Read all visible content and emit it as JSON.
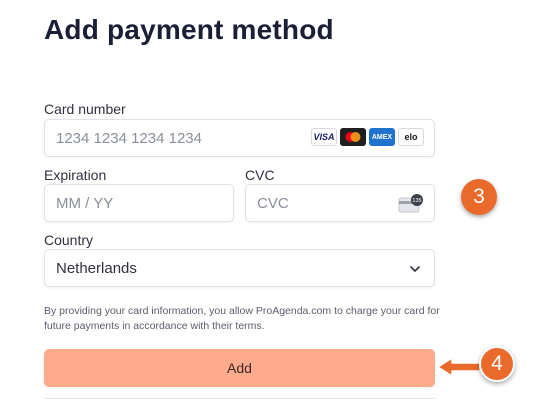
{
  "page": {
    "title": "Add payment method"
  },
  "card_number": {
    "label": "Card number",
    "placeholder": "1234 1234 1234 1234",
    "brands": [
      {
        "name": "VISA",
        "icon": "visa-icon",
        "bg": "#ffffff",
        "color": "#1a1f71"
      },
      {
        "name": "mastercard",
        "icon": "mastercard-icon",
        "bg": "#1f1f1f"
      },
      {
        "name": "AMEX",
        "icon": "amex-icon",
        "bg": "#1f72cd",
        "color": "#ffffff"
      },
      {
        "name": "elo",
        "icon": "elo-icon",
        "bg": "#ffffff",
        "color": "#1a1a1a"
      }
    ]
  },
  "expiration": {
    "label": "Expiration",
    "placeholder": "MM / YY"
  },
  "cvc": {
    "label": "CVC",
    "placeholder": "CVC",
    "icon": "cvc-card-icon",
    "icon_text": "135"
  },
  "country": {
    "label": "Country",
    "value": "Netherlands",
    "icon": "chevron-down-icon"
  },
  "notice": "By providing your card information, you allow ProAgenda.com to charge your card for future payments in accordance with their terms.",
  "add_button": {
    "label": "Add",
    "bg": "#ffab8c"
  },
  "annotations": {
    "step3": "3",
    "step4": "4",
    "color": "#ea6a2c"
  }
}
